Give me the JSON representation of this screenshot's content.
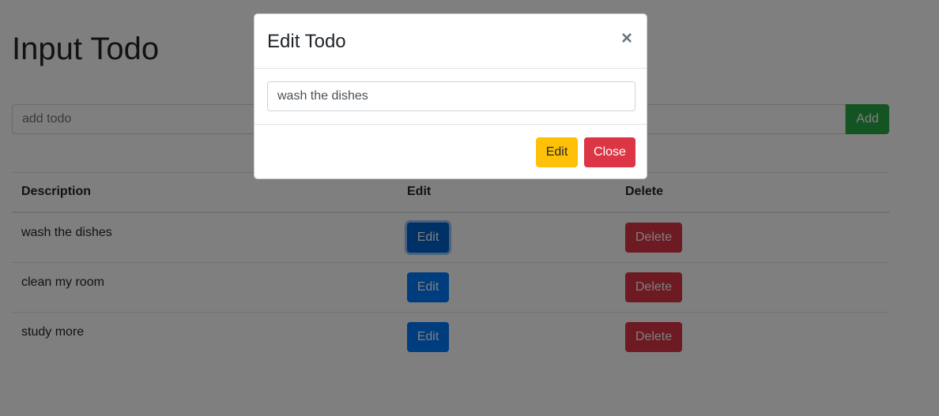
{
  "page": {
    "title": "Input Todo",
    "add_placeholder": "add todo",
    "add_button": "Add"
  },
  "table": {
    "headers": [
      "Description",
      "Edit",
      "Delete"
    ],
    "rows": [
      {
        "description": "wash the dishes",
        "edit": "Edit",
        "delete": "Delete"
      },
      {
        "description": "clean my room",
        "edit": "Edit",
        "delete": "Delete"
      },
      {
        "description": "study more",
        "edit": "Edit",
        "delete": "Delete"
      }
    ]
  },
  "modal": {
    "title": "Edit Todo",
    "close_icon": "close-icon",
    "input_value": "wash the dishes",
    "edit_button": "Edit",
    "close_button": "Close"
  },
  "colors": {
    "primary": "#007bff",
    "success": "#28a745",
    "danger": "#dc3545",
    "warning": "#ffc107"
  }
}
